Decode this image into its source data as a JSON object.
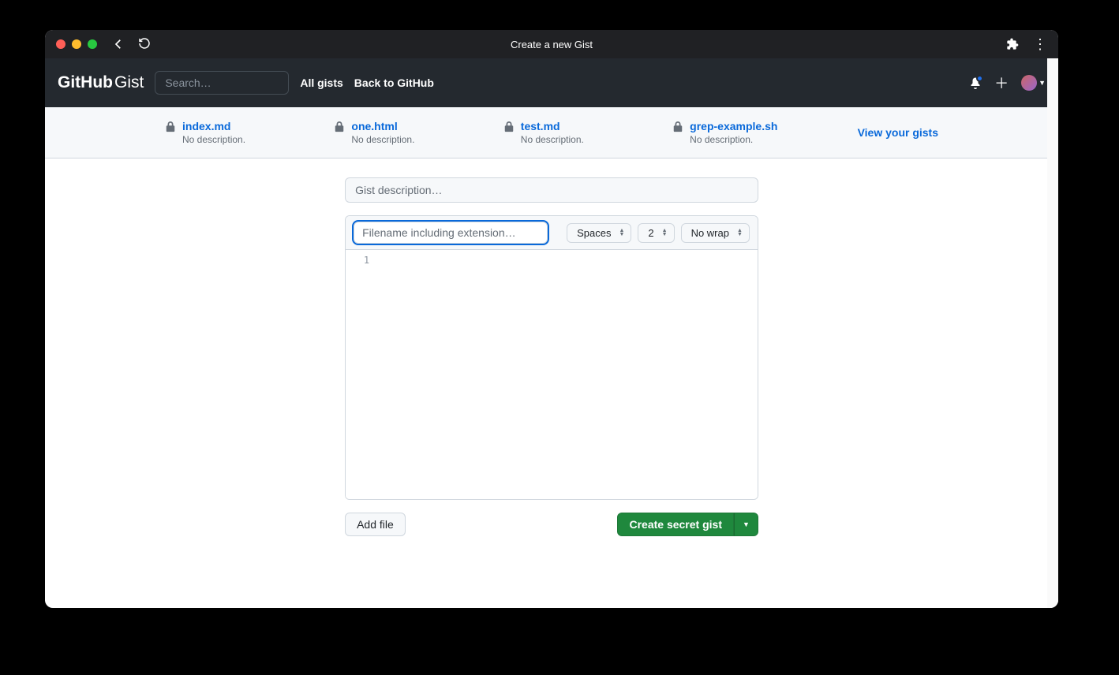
{
  "chrome": {
    "title": "Create a new Gist"
  },
  "header": {
    "logo_bold": "GitHub",
    "logo_thin": "Gist",
    "search_placeholder": "Search…",
    "link_all": "All gists",
    "link_back": "Back to GitHub"
  },
  "recent": {
    "items": [
      {
        "name": "index.md",
        "desc": "No description."
      },
      {
        "name": "one.html",
        "desc": "No description."
      },
      {
        "name": "test.md",
        "desc": "No description."
      },
      {
        "name": "grep-example.sh",
        "desc": "No description."
      }
    ],
    "view_all": "View your gists"
  },
  "form": {
    "desc_placeholder": "Gist description…",
    "filename_placeholder": "Filename including extension…",
    "indent_mode": "Spaces",
    "indent_size": "2",
    "wrap_mode": "No wrap",
    "line_number": "1",
    "add_file": "Add file",
    "create_secret": "Create secret gist"
  }
}
